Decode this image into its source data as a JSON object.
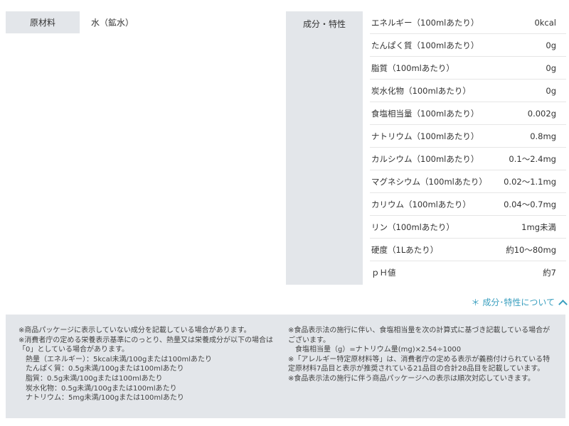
{
  "ingredients": {
    "label": "原材料",
    "value": "水（鉱水）"
  },
  "nutrition": {
    "label": "成分・特性",
    "rows": [
      {
        "name": "エネルギー（100mlあたり）",
        "value": "0kcal"
      },
      {
        "name": "たんぱく質（100mlあたり）",
        "value": "0g"
      },
      {
        "name": "脂質（100mlあたり）",
        "value": "0g"
      },
      {
        "name": "炭水化物（100mlあたり）",
        "value": "0g"
      },
      {
        "name": "食塩相当量（100mlあたり）",
        "value": "0.002g"
      },
      {
        "name": "ナトリウム（100mlあたり）",
        "value": "0.8mg"
      },
      {
        "name": "カルシウム（100mlあたり）",
        "value": "0.1～2.4mg"
      },
      {
        "name": "マグネシウム（100mlあたり）",
        "value": "0.02～1.1mg"
      },
      {
        "name": "カリウム（100mlあたり）",
        "value": "0.04～0.7mg"
      },
      {
        "name": "リン（100mlあたり）",
        "value": "1mg未満"
      },
      {
        "name": "硬度（1Lあたり）",
        "value": "約10～80mg"
      },
      {
        "name": "ｐＨ値",
        "value": "約7"
      }
    ]
  },
  "toggle": {
    "label": "＊ 成分･特性について",
    "icon": "chevron-up-icon",
    "color": "#3a9fbf"
  },
  "notes": {
    "left": [
      "※商品パッケージに表示していない成分を記載している場合があります。",
      "※消費者庁の定める栄養表示基準にのっとり、熱量又は栄養成分が以下の場合は「0」としている場合があります。",
      "　熱量（エネルギー）：5kcal未満/100gまたは100mlあたり",
      "　たんぱく質：0.5g未満/100gまたは100mlあたり",
      "　脂質：0.5g未満/100gまたは100mlあたり",
      "　炭水化物：0.5g未満/100gまたは100mlあたり",
      "　ナトリウム：5mg未満/100gまたは100mlあたり"
    ],
    "right": [
      "※食品表示法の施行に伴い、食塩相当量を次の計算式に基づき記載している場合がございます。",
      "　食塩相当量（g）=ナトリウム量(mg)×2.54÷1000",
      "※「アレルギー特定原材料等」は、消費者庁の定める表示が義務付けられている特定原材料7品目と表示が推奨されている21品目の合計28品目を記載しています。",
      "※食品表示法の施行に伴う商品パッケージへの表示は順次対応していきます。"
    ]
  }
}
